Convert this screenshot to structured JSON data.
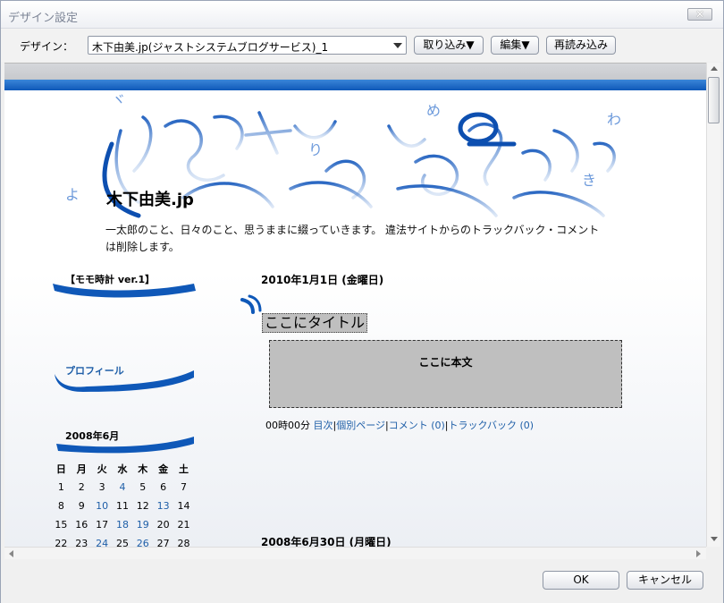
{
  "window": {
    "title": "デザイン設定",
    "close_glyph": "✕"
  },
  "toolbar": {
    "design_label": "デザイン：",
    "design_select_value": "木下由美.jp(ジャストシステムブログサービス)_1",
    "import_button": "取り込み▼",
    "edit_button": "編集▼",
    "reload_button": "再読み込み"
  },
  "blog": {
    "title": "木下由美.jp",
    "description": "一太郎のこと、日々のこと、思うままに綴っていきます。 違法サイトからのトラックバック・コメントは削除します。",
    "accent_color": "#0f58b8"
  },
  "sidebar": {
    "clock_heading": "【モモ時計 ver.1】",
    "profile_heading": "プロフィール",
    "calendar_heading": "2008年6月",
    "weekdays": [
      "日",
      "月",
      "火",
      "水",
      "木",
      "金",
      "土"
    ],
    "weeks": [
      [
        "1",
        "2",
        "3",
        "4",
        "5",
        "6",
        "7"
      ],
      [
        "8",
        "9",
        "10",
        "11",
        "12",
        "13",
        "14"
      ],
      [
        "15",
        "16",
        "17",
        "18",
        "19",
        "20",
        "21"
      ],
      [
        "22",
        "23",
        "24",
        "25",
        "26",
        "27",
        "28"
      ]
    ],
    "linked_days": [
      "4",
      "10",
      "13",
      "18",
      "19",
      "24",
      "26"
    ]
  },
  "post1": {
    "date": "2010年1月1日 (金曜日)",
    "title": "ここにタイトル",
    "body": "ここに本文",
    "time": "00時00分",
    "link_index": "目次",
    "link_permalink": "個別ページ",
    "link_comment": "コメント (0)",
    "link_trackback": "トラックバック (0)",
    "sep": "|"
  },
  "post2": {
    "date": "2008年6月30日 (月曜日)"
  },
  "footer": {
    "ok_button": "OK",
    "cancel_button": "キャンセル"
  }
}
